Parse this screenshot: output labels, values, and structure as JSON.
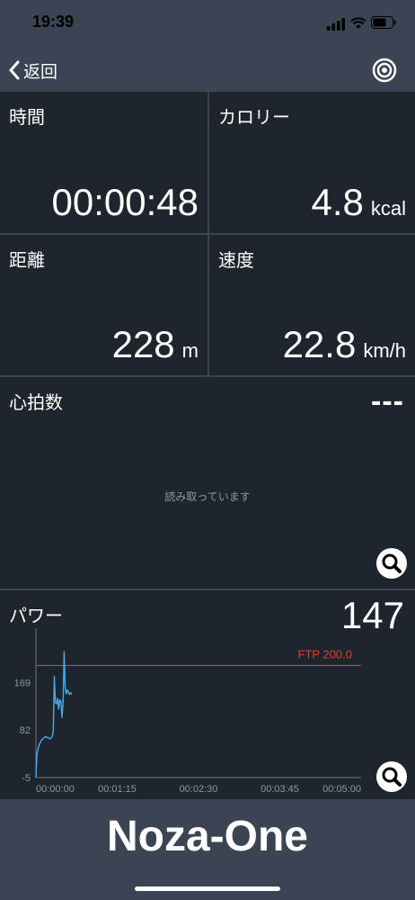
{
  "status": {
    "time": "19:39"
  },
  "nav": {
    "back_label": "返回"
  },
  "tiles": {
    "time": {
      "label": "時間",
      "value": "00:00:48",
      "unit": ""
    },
    "calories": {
      "label": "カロリー",
      "value": "4.8",
      "unit": "kcal"
    },
    "distance": {
      "label": "距離",
      "value": "228",
      "unit": "m"
    },
    "speed": {
      "label": "速度",
      "value": "22.8",
      "unit": "km/h"
    }
  },
  "heart_rate": {
    "label": "心拍数",
    "value": "---",
    "status": "読み取っています"
  },
  "power": {
    "label": "パワー",
    "value": "147"
  },
  "chart_data": {
    "type": "line",
    "title": "",
    "xlabel": "",
    "ylabel": "",
    "x_ticks": [
      "00:00:00",
      "00:01:15",
      "00:02:30",
      "00:03:45",
      "00:05:00"
    ],
    "y_ticks": [
      "-5",
      "82",
      "169"
    ],
    "x_range_seconds": [
      0,
      300
    ],
    "ylim": [
      -5,
      255
    ],
    "reference_line": {
      "label": "FTP 200.0",
      "value": 200,
      "color": "#e23b2e"
    },
    "series": [
      {
        "color": "#49a9e8",
        "points": [
          [
            0,
            -5
          ],
          [
            1,
            40
          ],
          [
            3,
            55
          ],
          [
            5,
            63
          ],
          [
            7,
            67
          ],
          [
            9,
            70
          ],
          [
            11,
            68
          ],
          [
            13,
            66
          ],
          [
            15,
            70
          ],
          [
            16,
            80
          ],
          [
            17,
            180
          ],
          [
            18,
            132
          ],
          [
            19,
            130
          ],
          [
            20,
            140
          ],
          [
            21,
            120
          ],
          [
            22,
            137
          ],
          [
            23,
            135
          ],
          [
            24,
            105
          ],
          [
            25,
            130
          ],
          [
            26,
            225
          ],
          [
            27,
            160
          ],
          [
            28,
            148
          ],
          [
            29,
            155
          ],
          [
            30,
            152
          ],
          [
            31,
            147
          ],
          [
            32,
            150
          ],
          [
            33,
            147
          ]
        ]
      }
    ]
  },
  "device": {
    "name": "Noza-One"
  }
}
